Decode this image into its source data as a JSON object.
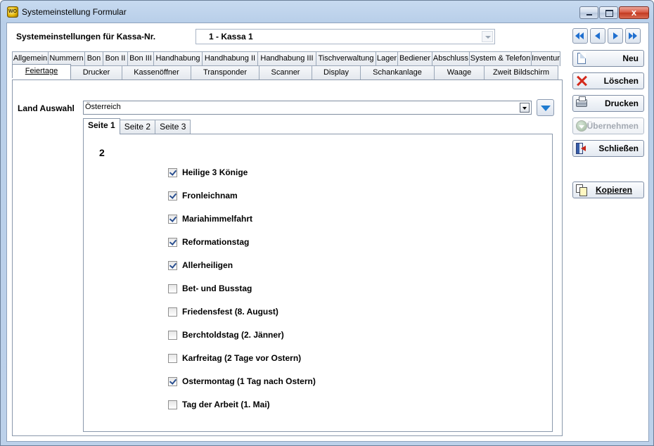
{
  "window": {
    "title": "Systemeinstellung Formular",
    "close_glyph": "x"
  },
  "header": {
    "kassa_label": "Systemeinstellungen für Kassa-Nr.",
    "kassa_value": "1 - Kassa 1"
  },
  "tabs_row1": [
    {
      "label": "Allgemein",
      "w": 52
    },
    {
      "label": "Nummern",
      "w": 53
    },
    {
      "label": "Bon",
      "w": 27
    },
    {
      "label": "Bon II",
      "w": 36
    },
    {
      "label": "Bon III",
      "w": 38
    },
    {
      "label": "Handhabung",
      "w": 70
    },
    {
      "label": "Handhabung II",
      "w": 80
    },
    {
      "label": "Handhabung III",
      "w": 84
    },
    {
      "label": "Tischverwaltung",
      "w": 86
    },
    {
      "label": "Lager",
      "w": 32
    },
    {
      "label": "Bediener",
      "w": 50
    },
    {
      "label": "Abschluss",
      "w": 54
    },
    {
      "label": "System & Telefon",
      "w": 89
    },
    {
      "label": "Inventur",
      "w": 42
    }
  ],
  "tabs_row2": [
    {
      "label": "Feiertage",
      "w": 84,
      "active": true
    },
    {
      "label": "Drucker",
      "w": 74
    },
    {
      "label": "Kassenöffner",
      "w": 99
    },
    {
      "label": "Transponder",
      "w": 98
    },
    {
      "label": "Scanner",
      "w": 76
    },
    {
      "label": "Display",
      "w": 70
    },
    {
      "label": "Schankanlage",
      "w": 106
    },
    {
      "label": "Waage",
      "w": 72
    },
    {
      "label": "Zweit Bildschirm",
      "w": 106
    }
  ],
  "feiertage": {
    "land_label": "Land Auswahl",
    "land_value": "Österreich",
    "subtabs": [
      {
        "label": "Seite 1",
        "active": true
      },
      {
        "label": "Seite 2"
      },
      {
        "label": "Seite 3"
      }
    ],
    "page_number": "2",
    "holidays": [
      {
        "label": "Heilige 3 Könige",
        "checked": true
      },
      {
        "label": "Fronleichnam",
        "checked": true
      },
      {
        "label": "Mariahimmelfahrt",
        "checked": true
      },
      {
        "label": "Reformationstag",
        "checked": true
      },
      {
        "label": "Allerheiligen",
        "checked": true
      },
      {
        "label": "Bet- und Busstag",
        "checked": false
      },
      {
        "label": "Friedensfest (8. August)",
        "checked": false
      },
      {
        "label": "Berchtoldstag (2. Jänner)",
        "checked": false
      },
      {
        "label": "Karfreitag (2 Tage vor Ostern)",
        "checked": false
      },
      {
        "label": "Ostermontag (1 Tag nach Ostern)",
        "checked": true
      },
      {
        "label": "Tag der Arbeit (1. Mai)",
        "checked": false
      }
    ]
  },
  "side_buttons": {
    "neu": "Neu",
    "loeschen": "Löschen",
    "drucken": "Drucken",
    "uebernehmen": "Übernehmen",
    "schliessen": "Schließen",
    "kopieren": "Kopieren"
  },
  "icons": {
    "nav": [
      "first-record-icon",
      "previous-record-icon",
      "next-record-icon",
      "last-record-icon"
    ]
  }
}
